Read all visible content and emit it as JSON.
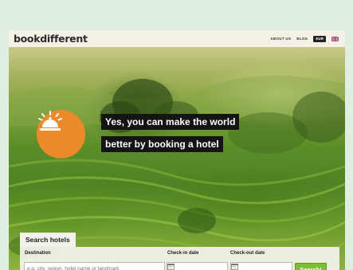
{
  "header": {
    "logo_text": "bookdifferent",
    "nav": {
      "about_label": "ABOUT US",
      "blog_label": "BLOG",
      "currency_label": "EUR",
      "language_icon": "uk-flag-icon"
    }
  },
  "hero": {
    "bell_icon": "service-bell-icon",
    "tagline_line1": "Yes, you can make the world",
    "tagline_line2": "better by booking a hotel"
  },
  "search": {
    "tab_label": "Search hotels",
    "destination_label": "Destination",
    "destination_placeholder": "e.g. city, region, hotel name or landmark",
    "destination_value": "",
    "checkin_label": "Check-in date",
    "checkin_value": "",
    "checkout_label": "Check-out date",
    "checkout_value": "",
    "calendar_icon": "calendar-icon",
    "submit_label": "Search!"
  },
  "colors": {
    "page_background": "#dfeede",
    "header_background": "#f4f1e7",
    "bell_circle": "#ea8a2a",
    "tagline_background": "#141414",
    "search_button": "#7cbf34"
  }
}
